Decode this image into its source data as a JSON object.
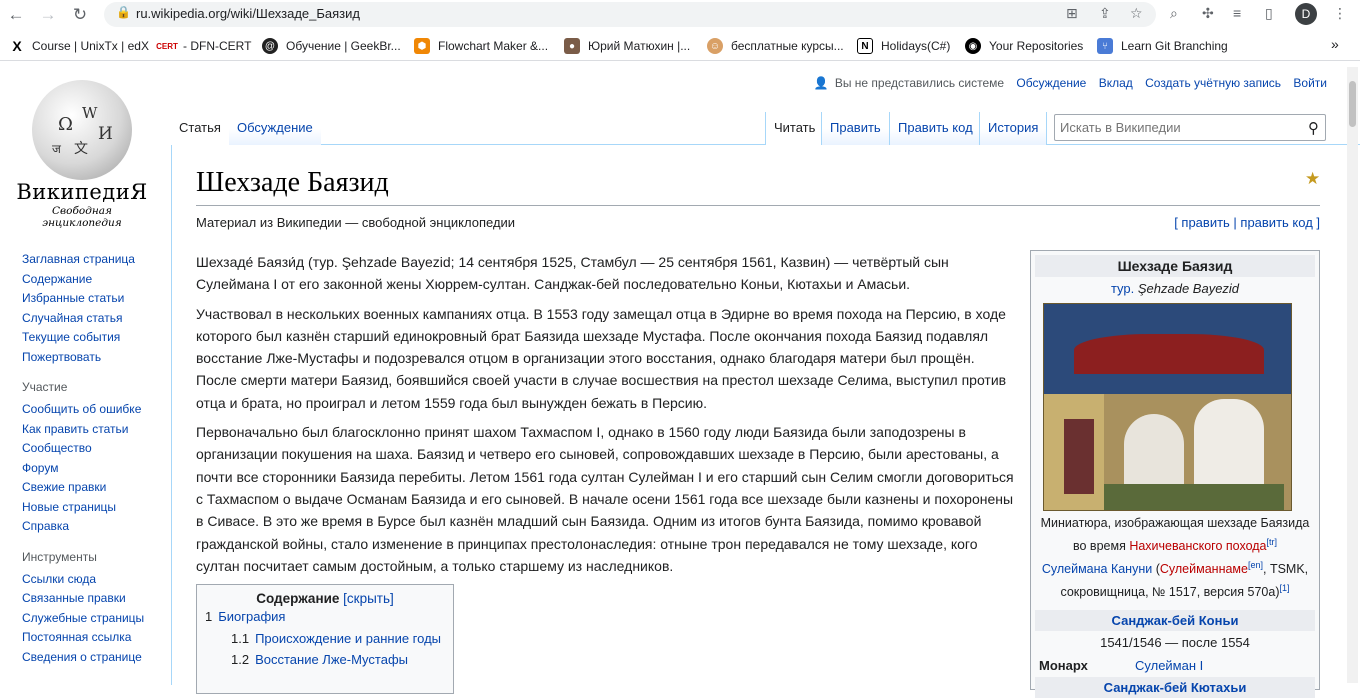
{
  "browser": {
    "url": "ru.wikipedia.org/wiki/Шехзаде_Баязид",
    "profile_initial": "D",
    "bookmarks": [
      "Course | UnixTx | edX",
      "- DFN-CERT",
      "Обучение | GeekBr...",
      "Flowchart Maker &...",
      "Юрий Матюхин |...",
      "бесплатные курсы...",
      "Holidays(C#)",
      "Your Repositories",
      "Learn Git Branching"
    ],
    "more": "»"
  },
  "logo": {
    "name": "ВикипедиЯ",
    "subtitle": "Свободная энциклопедия"
  },
  "sidebar": {
    "main": [
      "Заглавная страница",
      "Содержание",
      "Избранные статьи",
      "Случайная статья",
      "Текущие события",
      "Пожертвовать"
    ],
    "participation_head": "Участие",
    "participation": [
      "Сообщить об ошибке",
      "Как править статьи",
      "Сообщество",
      "Форум",
      "Свежие правки",
      "Новые страницы",
      "Справка"
    ],
    "tools_head": "Инструменты",
    "tools": [
      "Ссылки сюда",
      "Связанные правки",
      "Служебные страницы",
      "Постоянная ссылка",
      "Сведения о странице"
    ]
  },
  "userbar": {
    "not_logged": "Вы не представились системе",
    "talk": "Обсуждение",
    "contrib": "Вклад",
    "create": "Создать учётную запись",
    "login": "Войти"
  },
  "tabs": {
    "article": "Статья",
    "discussion": "Обсуждение",
    "read": "Читать",
    "edit": "Править",
    "edit_code": "Править код",
    "history": "История"
  },
  "search": {
    "placeholder": "Искать в Википедии"
  },
  "article": {
    "title": "Шехзаде Баязид",
    "tagline": "Материал из Википедии — свободной энциклопедии",
    "edit_links": "[ править | править код ]",
    "p1": "Шехзаде́ Баязи́д (тур. Şehzade Bayezid; 14 сентября 1525, Стамбул — 25 сентября 1561, Казвин) — четвёртый сын Сулеймана I от его законной жены Хюррем-султан. Санджак-бей последовательно Коньи, Кютахьи и Амасьи.",
    "p2": "Участвовал в нескольких военных кампаниях отца. В 1553 году замещал отца в Эдирне во время похода на Персию, в ходе которого был казнён старший единокровный брат Баязида шехзаде Мустафа. После окончания похода Баязид подавлял восстание Лже-Мустафы и подозревался отцом в организации этого восстания, однако благодаря матери был прощён. После смерти матери Баязид, боявшийся своей участи в случае восшествия на престол шехзаде Селима, выступил против отца и брата, но проиграл и летом 1559 года был вынужден бежать в Персию.",
    "p3": "Первоначально был благосклонно принят шахом Тахмаспом I, однако в 1560 году люди Баязида были заподозрены в организации покушения на шаха. Баязид и четверо его сыновей, сопровождавших шехзаде в Персию, были арестованы, а почти все сторонники Баязида перебиты. Летом 1561 года султан Сулейман I и его старший сын Селим смогли договориться с Тахмаспом о выдаче Османам Баязида и его сыновей. В начале осени 1561 года все шехзаде были казнены и похоронены в Сивасе. В это же время в Бурсе был казнён младший сын Баязида. Одним из итогов бунта Баязида, помимо кровавой гражданской войны, стало изменение в принципах престолонаследия: отныне трон передавался не тому шехзаде, кого султан посчитает самым достойным, а только старшему из наследников."
  },
  "toc": {
    "title": "Содержание",
    "toggle": "[скрыть]",
    "items": [
      {
        "num": "1",
        "text": "Биография"
      },
      {
        "num": "1.1",
        "text": "Происхождение и ранние годы"
      },
      {
        "num": "1.2",
        "text": "Восстание Лже-Мустафы"
      }
    ]
  },
  "infobox": {
    "title": "Шехзаде Баязид",
    "turkish_prefix": "тур.",
    "turkish_name": "Şehzade Bayezid",
    "caption_1": "Миниатюра, изображающая шехзаде Баязида во время",
    "caption_link": "Нахичеванского похода",
    "caption_sup1": "[tr]",
    "caption_2": "Сулеймана Кануни",
    "caption_3": "(",
    "caption_link2": "Сулейманнаме",
    "caption_sup2": "[en]",
    "caption_4": ", TSMK, сокровищница, № 1517, версия 570a)",
    "caption_sup3": "[1]",
    "section1": "Санджак-бей Коньи",
    "section1_dates": "1541/1546 — после 1554",
    "monarch_label": "Монарх",
    "monarch_value": "Сулейман I",
    "section2": "Санджак-бей Кютахьи"
  }
}
